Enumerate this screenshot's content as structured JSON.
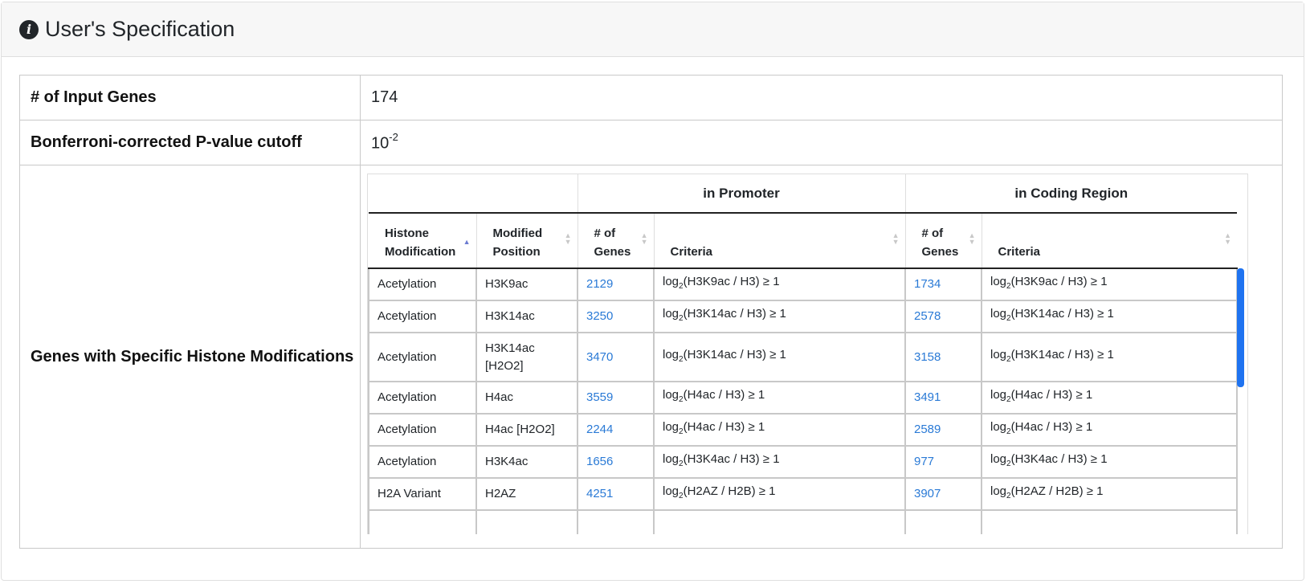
{
  "header": {
    "title": "User's Specification",
    "icon": "info-circle-icon"
  },
  "spec": {
    "input_genes_label": "# of Input Genes",
    "input_genes_value": "174",
    "pvalue_label": "Bonferroni-corrected P-value cutoff",
    "pvalue_base": "10",
    "pvalue_exp": "-2",
    "histone_label": "Genes with Specific Histone Modifications"
  },
  "histone_table": {
    "group_promoter": "in Promoter",
    "group_coding": "in Coding Region",
    "col_histone_l1": "Histone",
    "col_histone_l2": "Modification",
    "col_position_l1": "Modified",
    "col_position_l2": "Position",
    "col_genes_l1": "# of",
    "col_genes_l2": "Genes",
    "col_criteria": "Criteria",
    "rows": [
      {
        "mod": "Acetylation",
        "pos": "H3K9ac",
        "p_genes": "2129",
        "p_crit_pre": "log",
        "p_crit_sub": "2",
        "p_crit_post": "(H3K9ac / H3) ≥ 1",
        "c_genes": "1734",
        "c_crit_pre": "log",
        "c_crit_sub": "2",
        "c_crit_post": "(H3K9ac / H3) ≥ 1"
      },
      {
        "mod": "Acetylation",
        "pos": "H3K14ac",
        "p_genes": "3250",
        "p_crit_pre": "log",
        "p_crit_sub": "2",
        "p_crit_post": "(H3K14ac / H3) ≥ 1",
        "c_genes": "2578",
        "c_crit_pre": "log",
        "c_crit_sub": "2",
        "c_crit_post": "(H3K14ac / H3) ≥ 1"
      },
      {
        "mod": "Acetylation",
        "pos": "H3K14ac [H2O2]",
        "p_genes": "3470",
        "p_crit_pre": "log",
        "p_crit_sub": "2",
        "p_crit_post": "(H3K14ac / H3) ≥ 1",
        "c_genes": "3158",
        "c_crit_pre": "log",
        "c_crit_sub": "2",
        "c_crit_post": "(H3K14ac / H3) ≥ 1"
      },
      {
        "mod": "Acetylation",
        "pos": "H4ac",
        "p_genes": "3559",
        "p_crit_pre": "log",
        "p_crit_sub": "2",
        "p_crit_post": "(H4ac / H3) ≥ 1",
        "c_genes": "3491",
        "c_crit_pre": "log",
        "c_crit_sub": "2",
        "c_crit_post": "(H4ac / H3) ≥ 1"
      },
      {
        "mod": "Acetylation",
        "pos": "H4ac [H2O2]",
        "p_genes": "2244",
        "p_crit_pre": "log",
        "p_crit_sub": "2",
        "p_crit_post": "(H4ac / H3) ≥ 1",
        "c_genes": "2589",
        "c_crit_pre": "log",
        "c_crit_sub": "2",
        "c_crit_post": "(H4ac / H3) ≥ 1"
      },
      {
        "mod": "Acetylation",
        "pos": "H3K4ac",
        "p_genes": "1656",
        "p_crit_pre": "log",
        "p_crit_sub": "2",
        "p_crit_post": "(H3K4ac / H3) ≥ 1",
        "c_genes": "977",
        "c_crit_pre": "log",
        "c_crit_sub": "2",
        "c_crit_post": "(H3K4ac / H3) ≥ 1"
      },
      {
        "mod": "H2A Variant",
        "pos": "H2AZ",
        "p_genes": "4251",
        "p_crit_pre": "log",
        "p_crit_sub": "2",
        "p_crit_post": "(H2AZ / H2B) ≥ 1",
        "c_genes": "3907",
        "c_crit_pre": "log",
        "c_crit_sub": "2",
        "c_crit_post": "(H2AZ / H2B) ≥ 1"
      }
    ]
  },
  "colors": {
    "link": "#2a7ad6",
    "scrollbar": "#1f73f0",
    "sort_active": "#6b7bd1"
  }
}
